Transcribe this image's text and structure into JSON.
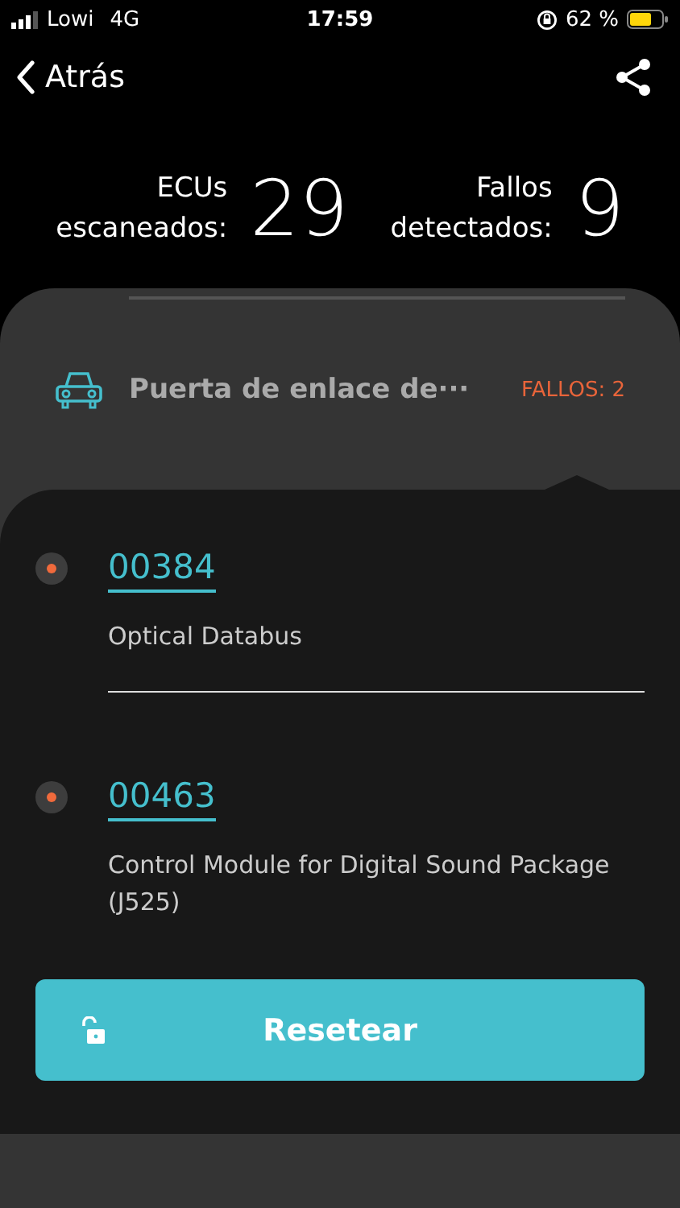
{
  "status_bar": {
    "carrier": "Lowi",
    "network": "4G",
    "time": "17:59",
    "battery": "62 %"
  },
  "nav": {
    "back": "Atrás"
  },
  "stats": [
    {
      "label": "ECUs\nescaneados:",
      "value": "29"
    },
    {
      "label": "Fallos\ndetectados:",
      "value": "9"
    }
  ],
  "module": {
    "name": "Puerta de enlace de···",
    "faults": "FALLOS: 2"
  },
  "faults": [
    {
      "code": "00384",
      "description": "Optical Databus"
    },
    {
      "code": "00463",
      "description": "Control Module for Digital Sound Package (J525)"
    }
  ],
  "reset_button": "Resetear"
}
